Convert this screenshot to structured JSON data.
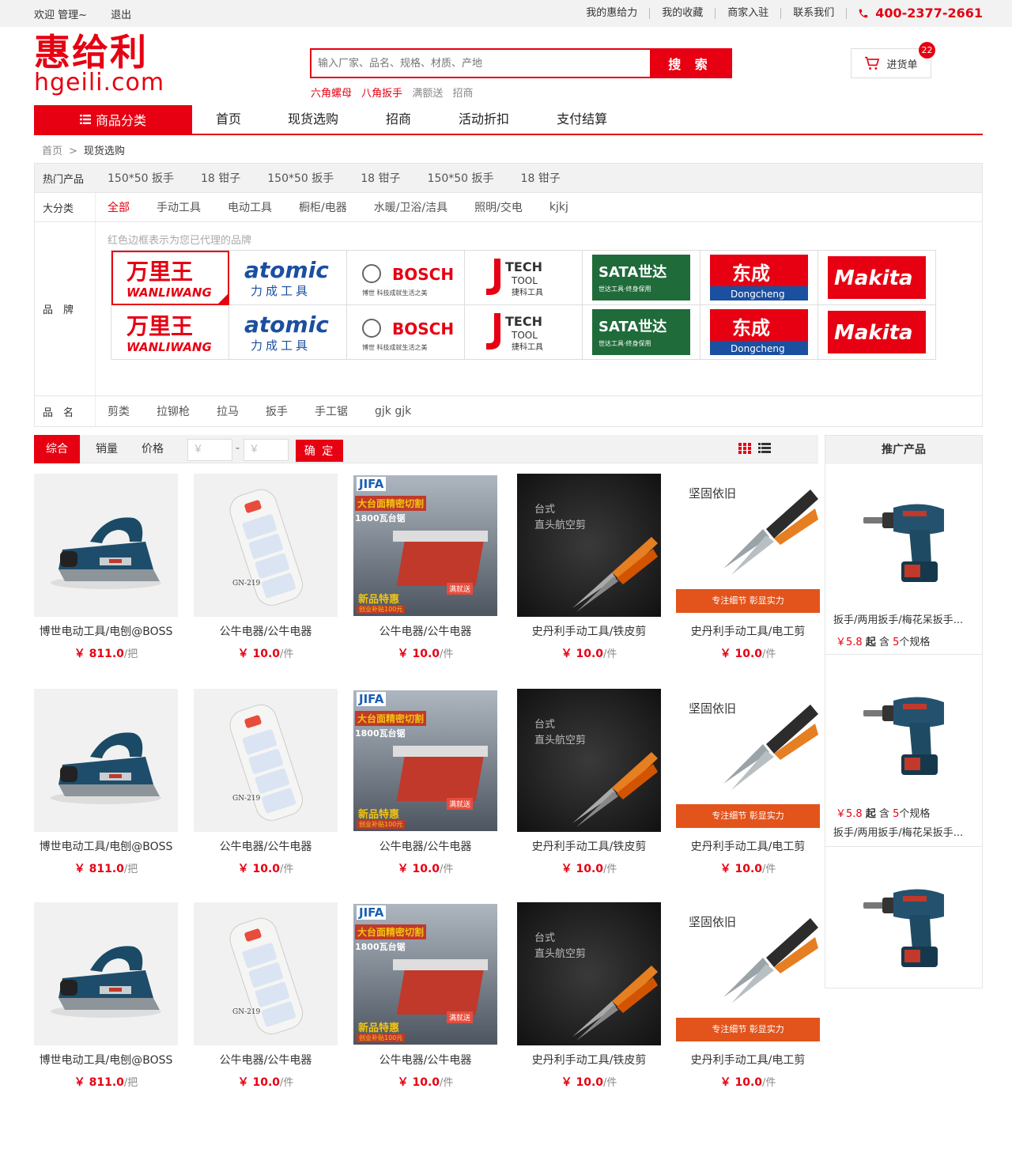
{
  "topbar": {
    "welcome": "欢迎 管理~",
    "logout": "退出",
    "links": [
      "我的惠给力",
      "我的收藏",
      "商家入驻",
      "联系我们"
    ],
    "phone": "400-2377-2661"
  },
  "header": {
    "logo_cn": "惠给利",
    "logo_en": "hgeili.com",
    "search_placeholder": "输入厂家、品名、规格、材质、产地",
    "search_button": "搜 索",
    "hotwords": [
      "六角螺母",
      "八角扳手",
      "满额送",
      "招商"
    ],
    "cart_label": "进货单",
    "cart_count": "22"
  },
  "nav": {
    "category": "商品分类",
    "items": [
      "首页",
      "现货选购",
      "招商",
      "活动折扣",
      "支付结算"
    ]
  },
  "breadcrumb": {
    "home": "首页",
    "sep": ">",
    "current": "现货选购"
  },
  "filter": {
    "hot_label": "热门产品",
    "hot_items": [
      "150*50 扳手",
      "18 钳子",
      "150*50 扳手",
      "18 钳子",
      "150*50 扳手",
      "18 钳子"
    ],
    "cat_label": "大分类",
    "cat_items": [
      "全部",
      "手动工具",
      "电动工具",
      "橱柜/电器",
      "水暖/卫浴/洁具",
      "照明/交电",
      "kjkj"
    ],
    "brand_label": "品　牌",
    "brand_tip": "红色边框表示为您已代理的品牌",
    "brands": [
      "万里王 WANLIWANG",
      "atomic 力成工具",
      "BOSCH 博世 科技成就生活之美",
      "J-TECH TOOL 捷科工具",
      "SATA世达 世达工具·终身保用",
      "东成 Dongcheng",
      "Makita"
    ],
    "name_label": "品　名",
    "name_items": [
      "剪类",
      "拉铆枪",
      "拉马",
      "扳手",
      "手工锯",
      "gjk gjk"
    ]
  },
  "sortbar": {
    "sorts": [
      "综合",
      "销量",
      "价格"
    ],
    "min_placeholder": "￥",
    "max_placeholder": "￥",
    "dash": "-",
    "confirm": "确 定"
  },
  "products": [
    {
      "name": "博世电动工具/电刨@BOSS",
      "price": "￥ 811.0",
      "unit": "/把",
      "img": "planer"
    },
    {
      "name": "公牛电器/公牛电器",
      "price": "￥ 10.0",
      "unit": "/件",
      "img": "socket"
    },
    {
      "name": "公牛电器/公牛电器",
      "price": "￥ 10.0",
      "unit": "/件",
      "img": "saw"
    },
    {
      "name": "史丹利手动工具/铁皮剪",
      "price": "￥ 10.0",
      "unit": "/件",
      "img": "snips"
    },
    {
      "name": "史丹利手动工具/电工剪",
      "price": "￥ 10.0",
      "unit": "/件",
      "img": "shears"
    }
  ],
  "product_images": {
    "socket_code": "GN-219",
    "saw_brand": "JIFA",
    "saw_title": "大台面精密切割",
    "saw_sub": "1800瓦台锯",
    "saw_badge": "满就送",
    "saw_promo": "新品特惠",
    "saw_bottom": "创业补贴100元",
    "snips_title": "台式",
    "snips_sub": "直头航空剪",
    "shears_title": "坚固依旧",
    "shears_bar": "专注细节 彰显实力"
  },
  "side": {
    "title": "推广产品",
    "items": [
      {
        "name": "扳手/两用扳手/梅花呆扳手...",
        "price": "￥5.8",
        "qi": "起",
        "han": "含",
        "count": "5",
        "spec": "个规格"
      },
      {
        "name": "扳手/两用扳手/梅花呆扳手...",
        "price": "￥5.8",
        "qi": "起",
        "han": "含",
        "count": "5",
        "spec": "个规格"
      }
    ]
  }
}
